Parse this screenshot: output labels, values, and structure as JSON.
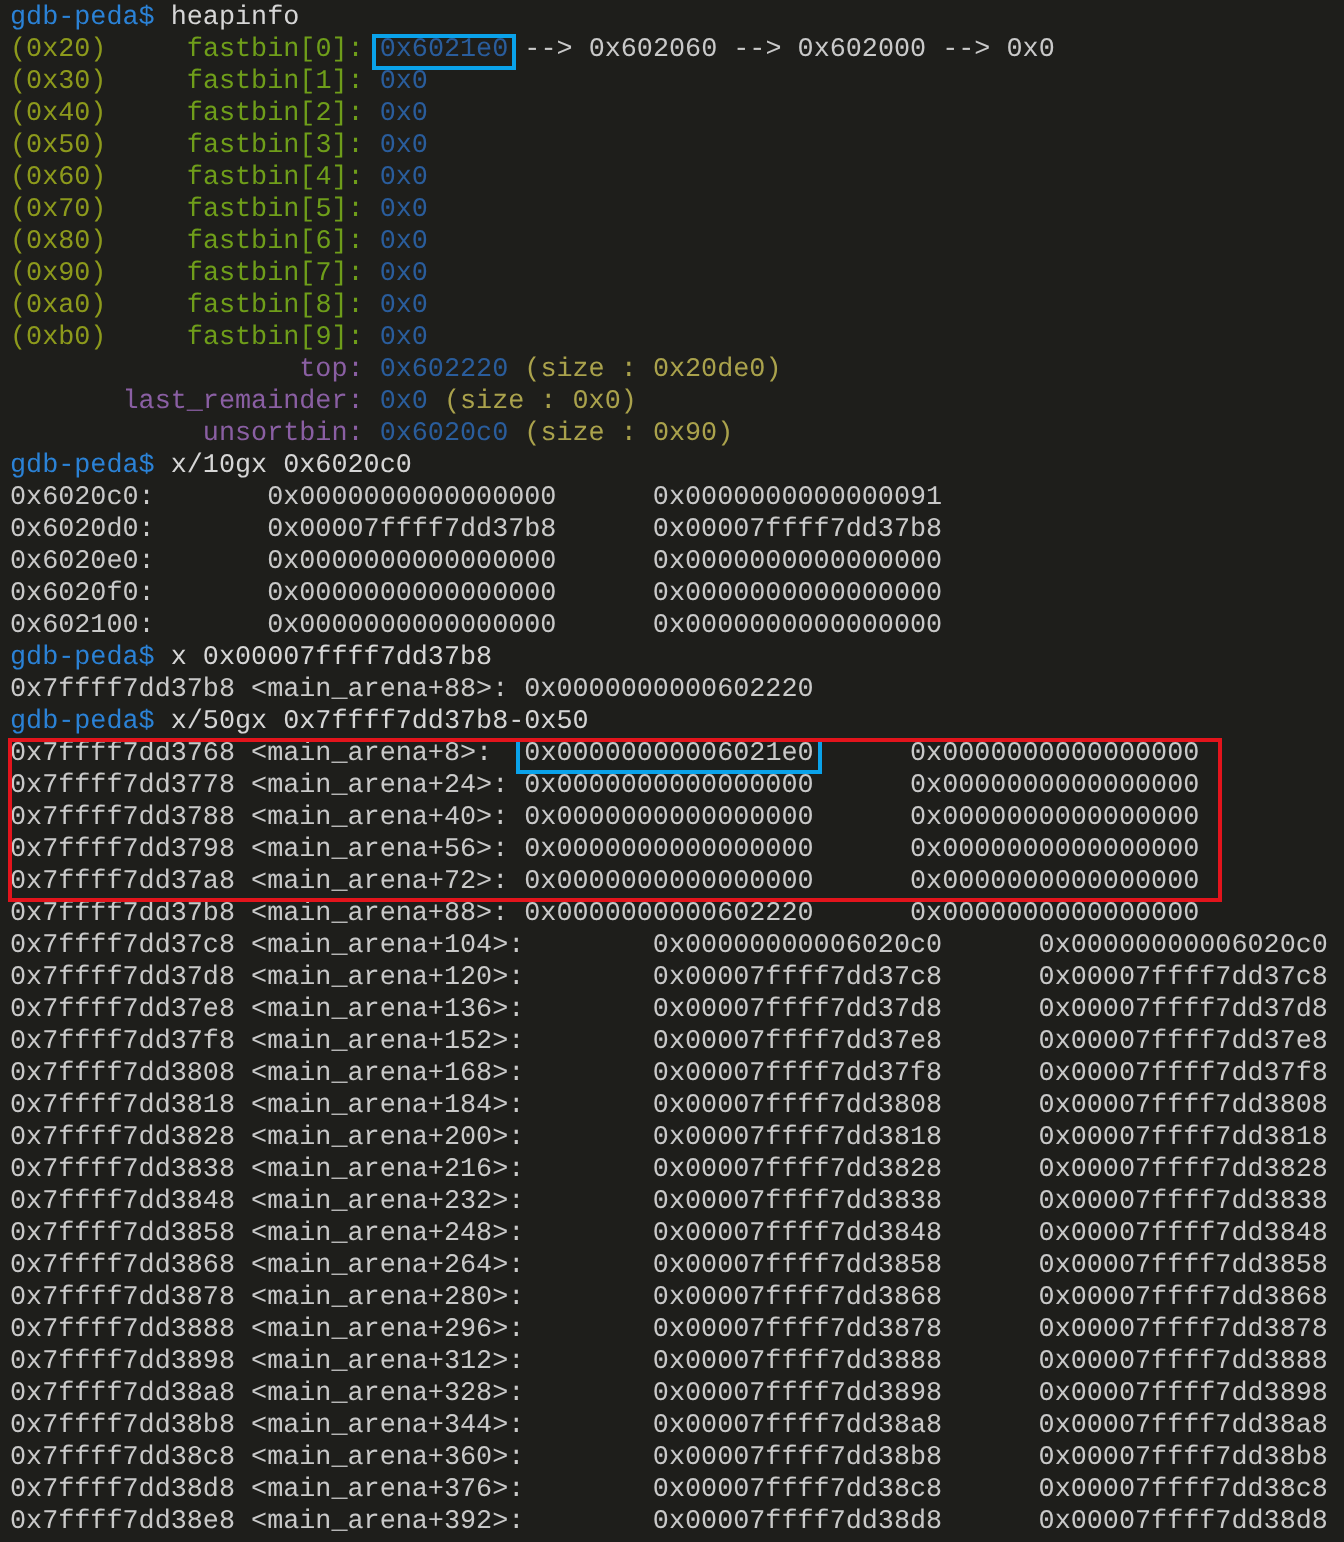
{
  "terminal": {
    "blocks": [
      {
        "outlined": false,
        "lines": [
          {
            "segments": [
              {
                "kind": "prompt",
                "text": "gdb-peda$"
              },
              {
                "kind": "command",
                "text": " heapinfo"
              }
            ]
          },
          {
            "segments": [
              {
                "kind": "size-class",
                "text": "(0x20)     "
              },
              {
                "kind": "bin-name",
                "text": "fastbin[0]: "
              },
              {
                "kind": "pointer",
                "text": "0x6021e0",
                "outline": true
              },
              {
                "kind": "output",
                "text": " --> 0x602060 --> 0x602000 --> 0x0"
              }
            ]
          },
          {
            "segments": [
              {
                "kind": "size-class",
                "text": "(0x30)     "
              },
              {
                "kind": "bin-name",
                "text": "fastbin[1]: "
              },
              {
                "kind": "pointer",
                "text": "0x0",
                "outline": false
              }
            ]
          },
          {
            "segments": [
              {
                "kind": "size-class",
                "text": "(0x40)     "
              },
              {
                "kind": "bin-name",
                "text": "fastbin[2]: "
              },
              {
                "kind": "pointer",
                "text": "0x0",
                "outline": false
              }
            ]
          },
          {
            "segments": [
              {
                "kind": "size-class",
                "text": "(0x50)     "
              },
              {
                "kind": "bin-name",
                "text": "fastbin[3]: "
              },
              {
                "kind": "pointer",
                "text": "0x0",
                "outline": false
              }
            ]
          },
          {
            "segments": [
              {
                "kind": "size-class",
                "text": "(0x60)     "
              },
              {
                "kind": "bin-name",
                "text": "fastbin[4]: "
              },
              {
                "kind": "pointer",
                "text": "0x0",
                "outline": false
              }
            ]
          },
          {
            "segments": [
              {
                "kind": "size-class",
                "text": "(0x70)     "
              },
              {
                "kind": "bin-name",
                "text": "fastbin[5]: "
              },
              {
                "kind": "pointer",
                "text": "0x0",
                "outline": false
              }
            ]
          },
          {
            "segments": [
              {
                "kind": "size-class",
                "text": "(0x80)     "
              },
              {
                "kind": "bin-name",
                "text": "fastbin[6]: "
              },
              {
                "kind": "pointer",
                "text": "0x0",
                "outline": false
              }
            ]
          },
          {
            "segments": [
              {
                "kind": "size-class",
                "text": "(0x90)     "
              },
              {
                "kind": "bin-name",
                "text": "fastbin[7]: "
              },
              {
                "kind": "pointer",
                "text": "0x0",
                "outline": false
              }
            ]
          },
          {
            "segments": [
              {
                "kind": "size-class",
                "text": "(0xa0)     "
              },
              {
                "kind": "bin-name",
                "text": "fastbin[8]: "
              },
              {
                "kind": "pointer",
                "text": "0x0",
                "outline": false
              }
            ]
          },
          {
            "segments": [
              {
                "kind": "size-class",
                "text": "(0xb0)     "
              },
              {
                "kind": "bin-name",
                "text": "fastbin[9]: "
              },
              {
                "kind": "pointer",
                "text": "0x0",
                "outline": false
              }
            ]
          },
          {
            "segments": [
              {
                "kind": "arena-field",
                "text": "                  top: "
              },
              {
                "kind": "pointer",
                "text": "0x602220",
                "outline": false
              },
              {
                "kind": "size-note",
                "text": " (size : 0x20de0)"
              }
            ]
          },
          {
            "segments": [
              {
                "kind": "arena-field",
                "text": "       last_remainder: "
              },
              {
                "kind": "pointer",
                "text": "0x0",
                "outline": false
              },
              {
                "kind": "size-note",
                "text": " (size : 0x0)"
              }
            ]
          },
          {
            "segments": [
              {
                "kind": "arena-field",
                "text": "            unsortbin: "
              },
              {
                "kind": "pointer",
                "text": "0x6020c0",
                "outline": false
              },
              {
                "kind": "size-note",
                "text": " (size : 0x90)"
              }
            ]
          },
          {
            "segments": [
              {
                "kind": "prompt",
                "text": "gdb-peda$"
              },
              {
                "kind": "command",
                "text": " x/10gx 0x6020c0"
              }
            ]
          },
          {
            "segments": [
              {
                "kind": "output",
                "text": "0x6020c0:       0x0000000000000000      0x0000000000000091"
              }
            ]
          },
          {
            "segments": [
              {
                "kind": "output",
                "text": "0x6020d0:       0x00007ffff7dd37b8      0x00007ffff7dd37b8"
              }
            ]
          },
          {
            "segments": [
              {
                "kind": "output",
                "text": "0x6020e0:       0x0000000000000000      0x0000000000000000"
              }
            ]
          },
          {
            "segments": [
              {
                "kind": "output",
                "text": "0x6020f0:       0x0000000000000000      0x0000000000000000"
              }
            ]
          },
          {
            "segments": [
              {
                "kind": "output",
                "text": "0x602100:       0x0000000000000000      0x0000000000000000"
              }
            ]
          },
          {
            "segments": [
              {
                "kind": "prompt",
                "text": "gdb-peda$"
              },
              {
                "kind": "command",
                "text": " x 0x00007ffff7dd37b8"
              }
            ]
          },
          {
            "segments": [
              {
                "kind": "output",
                "text": "0x7ffff7dd37b8 <main_arena+88>: 0x0000000000602220"
              }
            ]
          },
          {
            "segments": [
              {
                "kind": "prompt",
                "text": "gdb-peda$"
              },
              {
                "kind": "command",
                "text": " x/50gx 0x7ffff7dd37b8-0x50"
              }
            ]
          }
        ]
      },
      {
        "outlined": true,
        "lines": [
          {
            "segments": [
              {
                "kind": "output",
                "text": "0x7ffff7dd3768 <main_arena+8>:  "
              },
              {
                "kind": "output",
                "text": "0x00000000006021e0",
                "outline": true
              },
              {
                "kind": "output",
                "text": "      0x0000000000000000"
              }
            ]
          },
          {
            "segments": [
              {
                "kind": "output",
                "text": "0x7ffff7dd3778 <main_arena+24>: 0x0000000000000000      0x0000000000000000"
              }
            ]
          },
          {
            "segments": [
              {
                "kind": "output",
                "text": "0x7ffff7dd3788 <main_arena+40>: 0x0000000000000000      0x0000000000000000"
              }
            ]
          },
          {
            "segments": [
              {
                "kind": "output",
                "text": "0x7ffff7dd3798 <main_arena+56>: 0x0000000000000000      0x0000000000000000"
              }
            ]
          },
          {
            "segments": [
              {
                "kind": "output",
                "text": "0x7ffff7dd37a8 <main_arena+72>: 0x0000000000000000      0x0000000000000000"
              }
            ]
          }
        ]
      },
      {
        "outlined": false,
        "lines": [
          {
            "segments": [
              {
                "kind": "output",
                "text": "0x7ffff7dd37b8 <main_arena+88>: 0x0000000000602220      0x0000000000000000"
              }
            ]
          },
          {
            "segments": [
              {
                "kind": "output",
                "text": "0x7ffff7dd37c8 <main_arena+104>:        0x00000000006020c0      0x00000000006020c0"
              }
            ]
          },
          {
            "segments": [
              {
                "kind": "output",
                "text": "0x7ffff7dd37d8 <main_arena+120>:        0x00007ffff7dd37c8      0x00007ffff7dd37c8"
              }
            ]
          },
          {
            "segments": [
              {
                "kind": "output",
                "text": "0x7ffff7dd37e8 <main_arena+136>:        0x00007ffff7dd37d8      0x00007ffff7dd37d8"
              }
            ]
          },
          {
            "segments": [
              {
                "kind": "output",
                "text": "0x7ffff7dd37f8 <main_arena+152>:        0x00007ffff7dd37e8      0x00007ffff7dd37e8"
              }
            ]
          },
          {
            "segments": [
              {
                "kind": "output",
                "text": "0x7ffff7dd3808 <main_arena+168>:        0x00007ffff7dd37f8      0x00007ffff7dd37f8"
              }
            ]
          },
          {
            "segments": [
              {
                "kind": "output",
                "text": "0x7ffff7dd3818 <main_arena+184>:        0x00007ffff7dd3808      0x00007ffff7dd3808"
              }
            ]
          },
          {
            "segments": [
              {
                "kind": "output",
                "text": "0x7ffff7dd3828 <main_arena+200>:        0x00007ffff7dd3818      0x00007ffff7dd3818"
              }
            ]
          },
          {
            "segments": [
              {
                "kind": "output",
                "text": "0x7ffff7dd3838 <main_arena+216>:        0x00007ffff7dd3828      0x00007ffff7dd3828"
              }
            ]
          },
          {
            "segments": [
              {
                "kind": "output",
                "text": "0x7ffff7dd3848 <main_arena+232>:        0x00007ffff7dd3838      0x00007ffff7dd3838"
              }
            ]
          },
          {
            "segments": [
              {
                "kind": "output",
                "text": "0x7ffff7dd3858 <main_arena+248>:        0x00007ffff7dd3848      0x00007ffff7dd3848"
              }
            ]
          },
          {
            "segments": [
              {
                "kind": "output",
                "text": "0x7ffff7dd3868 <main_arena+264>:        0x00007ffff7dd3858      0x00007ffff7dd3858"
              }
            ]
          },
          {
            "segments": [
              {
                "kind": "output",
                "text": "0x7ffff7dd3878 <main_arena+280>:        0x00007ffff7dd3868      0x00007ffff7dd3868"
              }
            ]
          },
          {
            "segments": [
              {
                "kind": "output",
                "text": "0x7ffff7dd3888 <main_arena+296>:        0x00007ffff7dd3878      0x00007ffff7dd3878"
              }
            ]
          },
          {
            "segments": [
              {
                "kind": "output",
                "text": "0x7ffff7dd3898 <main_arena+312>:        0x00007ffff7dd3888      0x00007ffff7dd3888"
              }
            ]
          },
          {
            "segments": [
              {
                "kind": "output",
                "text": "0x7ffff7dd38a8 <main_arena+328>:        0x00007ffff7dd3898      0x00007ffff7dd3898"
              }
            ]
          },
          {
            "segments": [
              {
                "kind": "output",
                "text": "0x7ffff7dd38b8 <main_arena+344>:        0x00007ffff7dd38a8      0x00007ffff7dd38a8"
              }
            ]
          },
          {
            "segments": [
              {
                "kind": "output",
                "text": "0x7ffff7dd38c8 <main_arena+360>:        0x00007ffff7dd38b8      0x00007ffff7dd38b8"
              }
            ]
          },
          {
            "segments": [
              {
                "kind": "output",
                "text": "0x7ffff7dd38d8 <main_arena+376>:        0x00007ffff7dd38c8      0x00007ffff7dd38c8"
              }
            ]
          },
          {
            "segments": [
              {
                "kind": "output",
                "text": "0x7ffff7dd38e8 <main_arena+392>:        0x00007ffff7dd38d8      0x00007ffff7dd38d8"
              }
            ]
          }
        ]
      }
    ]
  }
}
